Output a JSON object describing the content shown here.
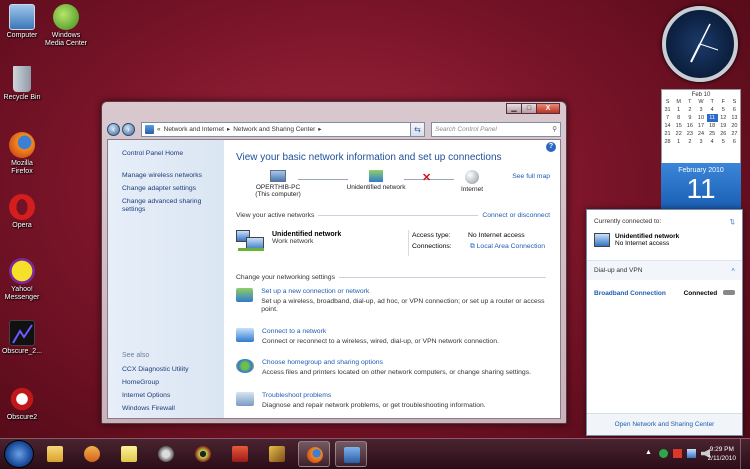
{
  "desktop_icons": [
    {
      "id": "computer",
      "label": "Computer",
      "icon": "computer-icon"
    },
    {
      "id": "wmc",
      "label": "Windows Media Center",
      "icon": "windows-media-center-icon"
    },
    {
      "id": "recycle",
      "label": "Recycle Bin",
      "icon": "recycle-bin-icon"
    },
    {
      "id": "firefox",
      "label": "Mozilla Firefox",
      "icon": "firefox-icon"
    },
    {
      "id": "opera",
      "label": "Opera",
      "icon": "opera-icon"
    },
    {
      "id": "yahoo",
      "label": "Yahoo! Messenger",
      "icon": "yahoo-messenger-icon"
    },
    {
      "id": "obscure",
      "label": "Obscure_2...",
      "icon": "obscure-icon"
    },
    {
      "id": "obscure2",
      "label": "Obscure2",
      "icon": "obscure2-icon"
    }
  ],
  "window": {
    "breadcrumb": [
      "Network and Internet",
      "Network and Sharing Center"
    ],
    "search_placeholder": "Search Control Panel",
    "buttons": {
      "minimize": "▁",
      "maximize": "□",
      "close": "X"
    }
  },
  "left_pane": {
    "home": "Control Panel Home",
    "links": [
      "Manage wireless networks",
      "Change adapter settings",
      "Change advanced sharing settings"
    ],
    "see_also_title": "See also",
    "see_also": [
      "CCX Diagnostic Utility",
      "HomeGroup",
      "Internet Options",
      "Windows Firewall"
    ]
  },
  "main": {
    "title": "View your basic network information and set up connections",
    "see_full_map": "See full map",
    "map": {
      "computer": "OPERTHIB-PC",
      "computer_sub": "(This computer)",
      "network": "Unidentified network",
      "internet": "Internet"
    },
    "active_header": "View your active networks",
    "connect_disconnect": "Connect or disconnect",
    "active": {
      "name": "Unidentified network",
      "kind": "Work network",
      "access_label": "Access type:",
      "access_value": "No Internet access",
      "connections_label": "Connections:",
      "connections_value": "Local Area Connection"
    },
    "change_header": "Change your networking settings",
    "tasks": [
      {
        "title": "Set up a new connection or network",
        "desc": "Set up a wireless, broadband, dial-up, ad hoc, or VPN connection; or set up a router or access point."
      },
      {
        "title": "Connect to a network",
        "desc": "Connect or reconnect to a wireless, wired, dial-up, or VPN network connection."
      },
      {
        "title": "Choose homegroup and sharing options",
        "desc": "Access files and printers located on other network computers, or change sharing settings."
      },
      {
        "title": "Troubleshoot problems",
        "desc": "Diagnose and repair network problems, or get troubleshooting information."
      }
    ]
  },
  "calendar": {
    "month_header": "Feb 10",
    "weekdays": [
      "S",
      "M",
      "T",
      "W",
      "T",
      "F",
      "S"
    ],
    "rows": [
      [
        "31",
        "1",
        "2",
        "3",
        "4",
        "5",
        "6"
      ],
      [
        "7",
        "8",
        "9",
        "10",
        "11",
        "12",
        "13"
      ],
      [
        "14",
        "15",
        "16",
        "17",
        "18",
        "19",
        "20"
      ],
      [
        "21",
        "22",
        "23",
        "24",
        "25",
        "26",
        "27"
      ],
      [
        "28",
        "1",
        "2",
        "3",
        "4",
        "5",
        "6"
      ]
    ],
    "selected": "11",
    "big_month": "February 2010",
    "big_day": "11"
  },
  "flyout": {
    "currently": "Currently connected to:",
    "net_name": "Unidentified network",
    "net_status": "No Internet access",
    "dialup": "Dial-up and VPN",
    "bb_name": "Broadband Connection",
    "bb_status": "Connected",
    "footer": "Open Network and Sharing Center"
  },
  "taskbar": {
    "time": "9:29 PM",
    "date": "2/11/2010"
  }
}
